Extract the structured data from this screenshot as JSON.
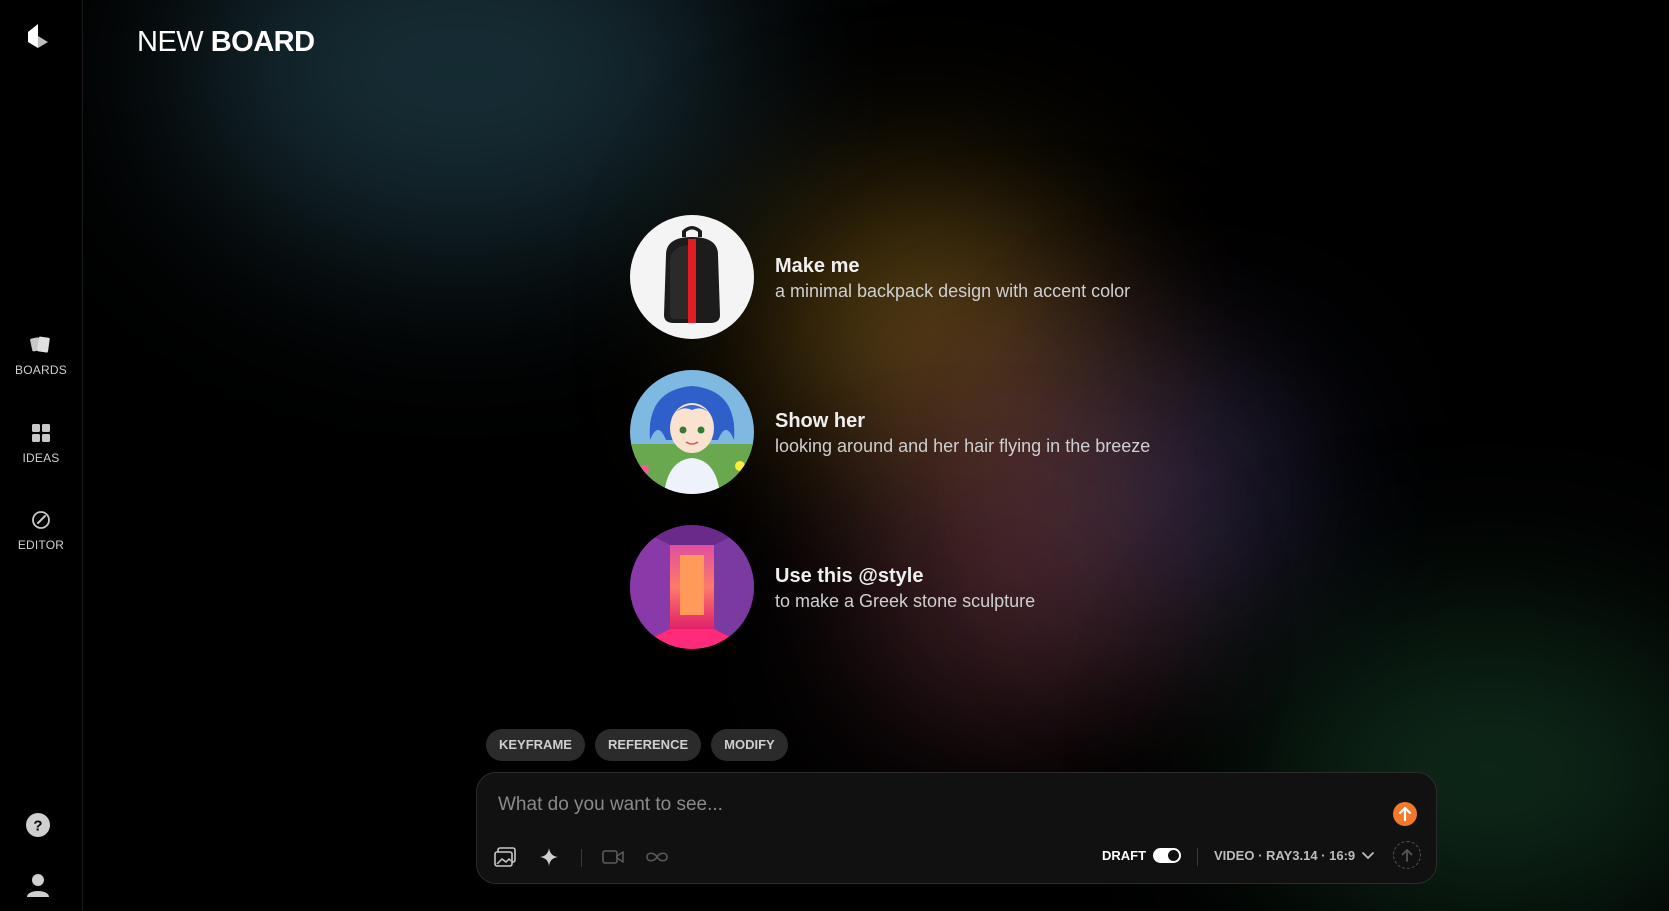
{
  "board": {
    "title_light": "NEW",
    "title_bold": "BOARD"
  },
  "sidebar": {
    "items": [
      {
        "label": "BOARDS",
        "icon": "boards-icon"
      },
      {
        "label": "IDEAS",
        "icon": "grid-icon"
      },
      {
        "label": "EDITOR",
        "icon": "edit-icon"
      }
    ],
    "bottom": [
      {
        "icon": "help-icon"
      },
      {
        "icon": "user-icon"
      }
    ]
  },
  "suggestions": [
    {
      "title": "Make me",
      "subtitle": "a minimal backpack design with accent color"
    },
    {
      "title": "Show her",
      "subtitle": "looking around and her hair flying in the breeze"
    },
    {
      "title": "Use this @style",
      "subtitle": "to make a Greek stone sculpture"
    }
  ],
  "chips": [
    "KEYFRAME",
    "REFERENCE",
    "MODIFY"
  ],
  "composer": {
    "placeholder": "What do you want to see...",
    "draft_label": "DRAFT",
    "model": "VIDEO · RAY3.14 · 16:9"
  },
  "colors": {
    "accent": "#f07a2a",
    "background": "#000000"
  }
}
